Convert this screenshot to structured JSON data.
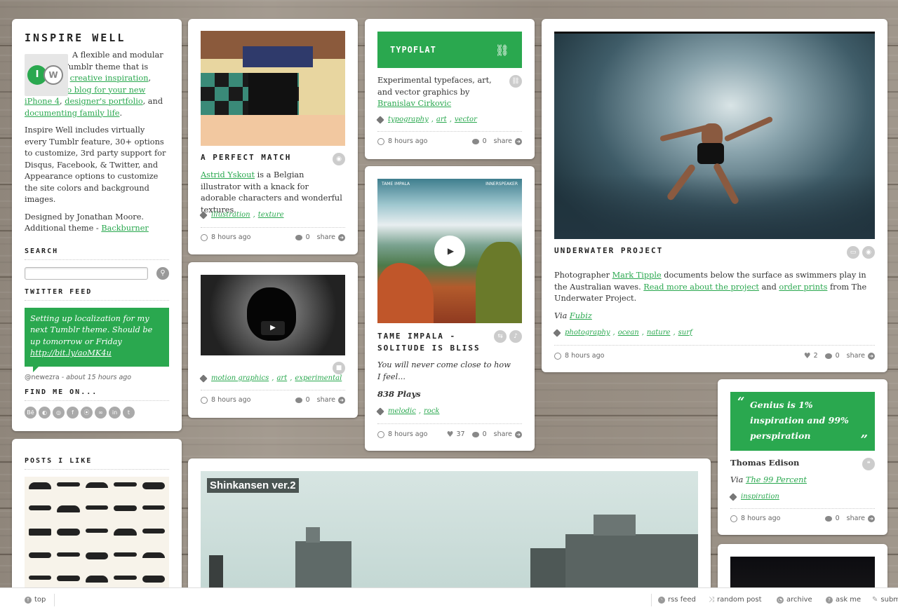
{
  "sidebar": {
    "title": "INSPIRE WELL",
    "logo_text": "IW",
    "intro_1": "A flexible and modular premium Tumblr theme that is perfect for ",
    "link_1": "creative inspiration",
    "sep_1": ", ",
    "link_2": "photo/video blog for your new iPhone 4",
    "sep_2": ", ",
    "link_3": "designer's portfolio",
    "sep_3": ", and ",
    "link_4": "documenting family life",
    "end": ".",
    "features": "Inspire Well includes virtually every Tumblr feature, 30+ options to customize, 3rd party support for Disqus, Facebook, & Twitter, and Appearance options to customize the site colors and background images.",
    "designer": "Designed by Jonathan Moore.",
    "additional": "Additional theme - ",
    "additional_link": "Backburner",
    "search_heading": "SEARCH",
    "search_placeholder": "",
    "twitter_heading": "TWITTER FEED",
    "tweet": "Setting up localization for my next Tumblr theme. Should be up tomorrow or Friday ",
    "tweet_link": "http://bit.ly/aoMK4u",
    "tweet_user": "@newezra",
    "tweet_time": " - about 15 hours ago",
    "findme_heading": "FIND ME ON...",
    "social": [
      "Bē",
      "◐",
      "◎",
      "f",
      "⦿",
      "∞",
      "in",
      "t"
    ]
  },
  "likes": {
    "heading": "POSTS I LIKE"
  },
  "post_match": {
    "title": "A PERFECT MATCH",
    "link": "Astrid Yskout",
    "text": " is a Belgian illustrator with a knack for adorable characters and wonderful textures.",
    "tags": [
      "illustration",
      "texture"
    ],
    "time": "8 hours ago",
    "notes": "0",
    "share": "share"
  },
  "post_video": {
    "tags": [
      "motion graphics",
      "art",
      "experimental"
    ],
    "time": "8 hours ago",
    "notes": "0",
    "share": "share"
  },
  "post_link": {
    "title": "TYPOFLAT",
    "text": "Experimental typefaces, art, and vector graphics by ",
    "link": "Branislav Cirkovic",
    "tags": [
      "typography",
      "art",
      "vector"
    ],
    "time": "8 hours ago",
    "notes": "0",
    "share": "share"
  },
  "post_audio": {
    "album_left": "TAME IMPALA",
    "album_right": "INNERSPEAKER",
    "title": "TAME IMPALA - SOLITUDE IS BLISS",
    "quote": "You will never come close to how I feel...",
    "plays": "838 Plays",
    "tags": [
      "melodic",
      "rock"
    ],
    "time": "8 hours ago",
    "likes": "37",
    "notes": "0",
    "share": "share"
  },
  "post_photo": {
    "title": "UNDERWATER PROJECT",
    "t1": "Photographer ",
    "link1": "Mark Tipple",
    "t2": " documents below the surface as swimmers play in the Australian waves.  ",
    "link2": "Read more about the project",
    "t3": " and ",
    "link3": "order prints",
    "t4": " from The Underwater Project.",
    "via": "Via ",
    "via_link": "Fubiz",
    "tags": [
      "photography",
      "ocean",
      "nature",
      "surf"
    ],
    "time": "8 hours ago",
    "likes": "2",
    "notes": "0",
    "share": "share"
  },
  "post_quote": {
    "quote": "Genius is 1% inspiration and 99% perspiration",
    "author": "Thomas Edison",
    "via": "Via ",
    "via_link": "The 99 Percent",
    "tags": [
      "inspiration"
    ],
    "time": "8 hours ago",
    "notes": "0",
    "share": "share"
  },
  "post_shinkansen": {
    "caption": "Shinkansen ver.2"
  },
  "footer": {
    "top": "top",
    "rss": "rss feed",
    "random": "random post",
    "archive": "archive",
    "ask": "ask me",
    "submit": "subm"
  },
  "colors": {
    "accent": "#2aa84f",
    "background": "#978d82"
  }
}
